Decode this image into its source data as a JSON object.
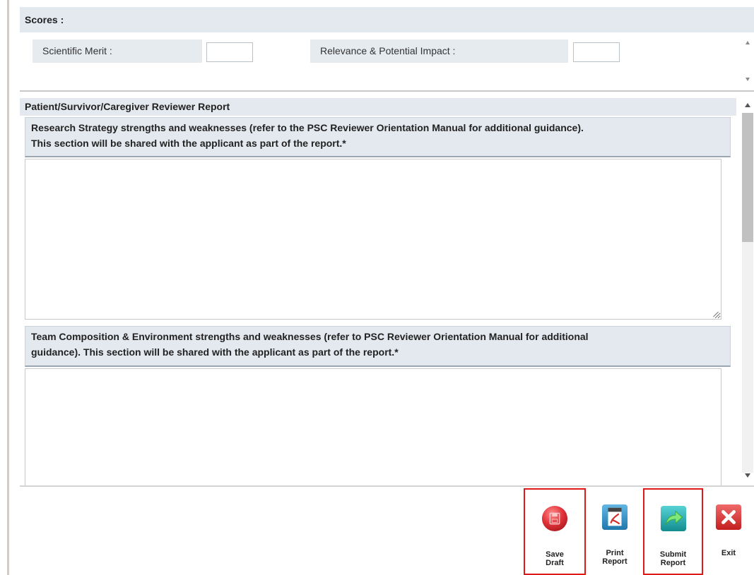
{
  "scores": {
    "title": "Scores :",
    "fields": [
      {
        "label": "Scientific Merit :",
        "value": ""
      },
      {
        "label": "Relevance & Potential Impact :",
        "value": ""
      }
    ]
  },
  "report": {
    "title": "Patient/Survivor/Caregiver Reviewer Report",
    "questions": [
      {
        "line1": "Research Strategy strengths and weaknesses (refer to the PSC Reviewer Orientation Manual for additional guidance).",
        "line2": "This section will be shared with the applicant as part of the report.*",
        "answer": ""
      },
      {
        "line1": "Team Composition & Environment strengths and weaknesses (refer to PSC Reviewer Orientation Manual for additional",
        "line2": "guidance). This section will be shared with the applicant as part of the report.*",
        "answer": ""
      }
    ]
  },
  "toolbar": {
    "save": {
      "line1": "Save",
      "line2": "Draft",
      "icon": "save-icon",
      "color": "#e0333a"
    },
    "print": {
      "line1": "Print",
      "line2": "Report",
      "icon": "pdf-icon",
      "color": "#2e93c9"
    },
    "submit": {
      "line1": "Submit",
      "line2": "Report",
      "icon": "forward-arrow-icon",
      "color": "#1fa5a8"
    },
    "exit": {
      "line1": "Exit",
      "icon": "close-icon",
      "color": "#d62f2f"
    }
  },
  "colors": {
    "section_header_bg": "#e4e9ef",
    "highlight_border": "#e01818"
  }
}
